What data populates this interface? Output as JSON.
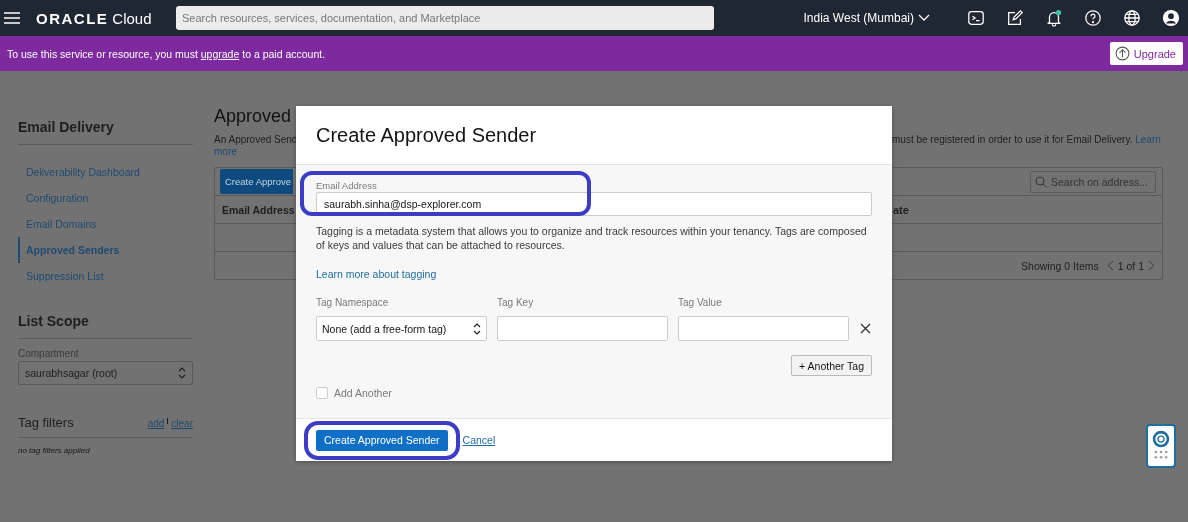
{
  "top_bar": {
    "wordmark": "ORACLE",
    "product": "Cloud",
    "search": {
      "placeholder": "Search resources, services, documentation, and Marketplace"
    },
    "region": "India West (Mumbai)",
    "notification_dot": true
  },
  "banner": {
    "text_before": "To use this service or resource, you must ",
    "link": "upgrade",
    "text_after": " to a paid account.",
    "button": "Upgrade"
  },
  "sidebar": {
    "title": "Email Delivery",
    "items": [
      {
        "label": "Deliverability Dashboard",
        "selected": false
      },
      {
        "label": "Configuration",
        "selected": false
      },
      {
        "label": "Email Domains",
        "selected": false
      },
      {
        "label": "Approved Senders",
        "selected": true
      },
      {
        "label": "Suppression List",
        "selected": false
      }
    ],
    "list_scope": {
      "title": "List Scope",
      "label": "Compartment",
      "value": "saurabhsagar (root)"
    },
    "tag_filters": {
      "title": "Tag filters",
      "add": "add",
      "clear": "clear",
      "empty": "no tag filters applied"
    }
  },
  "page": {
    "title": "Approved",
    "description_left": "An Approved Send",
    "description_more": "more",
    "description_right": "must be registered in order to use it for Email Delivery.",
    "description_learn": "Learn",
    "create_button": "Create Approve",
    "search": {
      "placeholder": "Search on address..."
    },
    "columns": [
      "Email Address",
      "ate"
    ],
    "count": "Showing 0 Items",
    "pager": "1 of 1"
  },
  "dialog": {
    "title": "Create Approved Sender",
    "email": {
      "label": "Email Address",
      "value": "saurabh.sinha@dsp-explorer.com",
      "highlighted": true
    },
    "tagging_text": "Tagging is a metadata system that allows you to organize and track resources within your tenancy. Tags are composed of keys and values that can be attached to resources.",
    "tagging_link": "Learn more about tagging",
    "tag_columns": [
      "Tag Namespace",
      "Tag Key",
      "Tag Value"
    ],
    "tag_namespace": "None (add a free-form tag)",
    "another_tag": "+ Another Tag",
    "add_another": {
      "label": "Add Another",
      "checked": false
    },
    "submit": {
      "label": "Create Approved Sender",
      "highlighted": true
    },
    "cancel": "Cancel"
  }
}
